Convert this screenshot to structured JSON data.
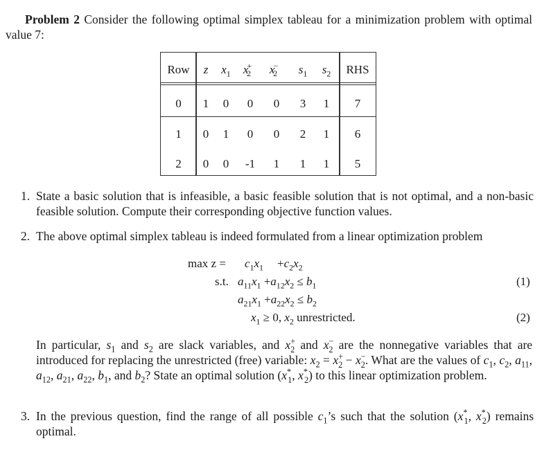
{
  "problem": {
    "label": "Problem 2",
    "intro": "Consider the following optimal simplex tableau for a minimization problem with optimal value 7:"
  },
  "tableau": {
    "headers": {
      "row": "Row",
      "vars": [
        "z",
        "x1",
        "x2+",
        "x2-",
        "s1",
        "s2"
      ],
      "rhs": "RHS"
    },
    "rows": [
      {
        "row": "0",
        "values": [
          "1",
          "0",
          "0",
          "0",
          "3",
          "1"
        ],
        "rhs": "7"
      },
      {
        "row": "1",
        "values": [
          "0",
          "1",
          "0",
          "0",
          "2",
          "1"
        ],
        "rhs": "6"
      },
      {
        "row": "2",
        "values": [
          "0",
          "0",
          "-1",
          "1",
          "1",
          "1"
        ],
        "rhs": "5"
      }
    ]
  },
  "questions": [
    {
      "number": "1.",
      "text": "State a basic solution that is infeasible, a basic feasible solution that is not optimal, and a non-basic feasible solution. Compute their corresponding objective function values."
    },
    {
      "number": "2.",
      "text": "The above optimal simplex tableau is indeed formulated from a linear optimization problem"
    },
    {
      "number": "3.",
      "text_a": "In the previous question, find the range of all possible",
      "text_b": "’s such that the solution",
      "text_c": "remains optimal."
    }
  ],
  "lp": {
    "objective_prefix": "max z =",
    "st": "s.t.",
    "unrestricted": "unrestricted.",
    "eq_labels": [
      "(1)",
      "(2)"
    ]
  },
  "paragraph": {
    "p1": "In particular,",
    "p2": "and",
    "p3": "are slack variables, and",
    "p4": "and",
    "p5": "are the nonnegative variables that are introduced for replacing the unrestricted (free) variable:",
    "p6": ". What are the values of",
    "p7": ", and",
    "p8": "? State an optimal solution",
    "p9": "to this linear optimization problem."
  }
}
